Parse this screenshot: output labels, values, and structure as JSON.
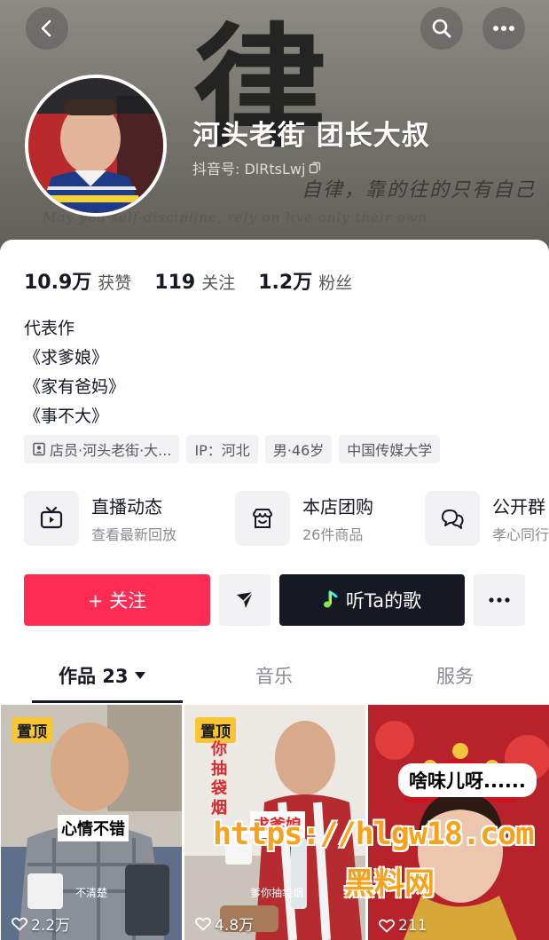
{
  "profile": {
    "nickname": "河头老街 团长大叔",
    "douyin_id": "抖音号: DlRtsLwj",
    "banner_calligraphy": "律",
    "banner_motto": "自律，靠的往的只有自己",
    "banner_motto_en": "May you self-discipline, rely on live only their own"
  },
  "stats": [
    {
      "value": "10.9万",
      "label": "获赞"
    },
    {
      "value": "119",
      "label": "关注"
    },
    {
      "value": "1.2万",
      "label": "粉丝"
    }
  ],
  "bio": {
    "heading": "代表作",
    "works": [
      "《求爹娘》",
      "《家有爸妈》",
      "《事不大》"
    ]
  },
  "tags": {
    "store": "店员·河头老街·大...",
    "ip": "IP：河北",
    "gender_age": "男·46岁",
    "school": "中国传媒大学"
  },
  "services": [
    {
      "title": "直播动态",
      "subtitle": "查看最新回放",
      "icon": "tv-icon"
    },
    {
      "title": "本店团购",
      "subtitle": "26件商品",
      "icon": "shop-icon"
    },
    {
      "title": "公开群",
      "subtitle": "孝心同行",
      "icon": "chat-icon"
    }
  ],
  "actions": {
    "follow": "+ 关注",
    "song": "听Ta的歌"
  },
  "tabs": {
    "works": "作品 23",
    "music": "音乐",
    "service": "服务"
  },
  "videos": [
    {
      "pinned": "置顶",
      "likes": "2.2万",
      "caption": "心情不错",
      "subcaption": "不清楚"
    },
    {
      "pinned": "置顶",
      "likes": "4.8万",
      "caption": "求爹娘",
      "vertical": "你抽袋烟",
      "subcaption": "爹你抽袋烟"
    },
    {
      "likes": "211",
      "caption": "啥味儿呀......"
    }
  ],
  "watermark": {
    "url": "https://hlgw18.com",
    "name": "黑料网"
  },
  "colors": {
    "accent": "#fe2c55",
    "dark_button": "#161823",
    "badge": "#f7c630",
    "watermark": "#f6a21a"
  }
}
